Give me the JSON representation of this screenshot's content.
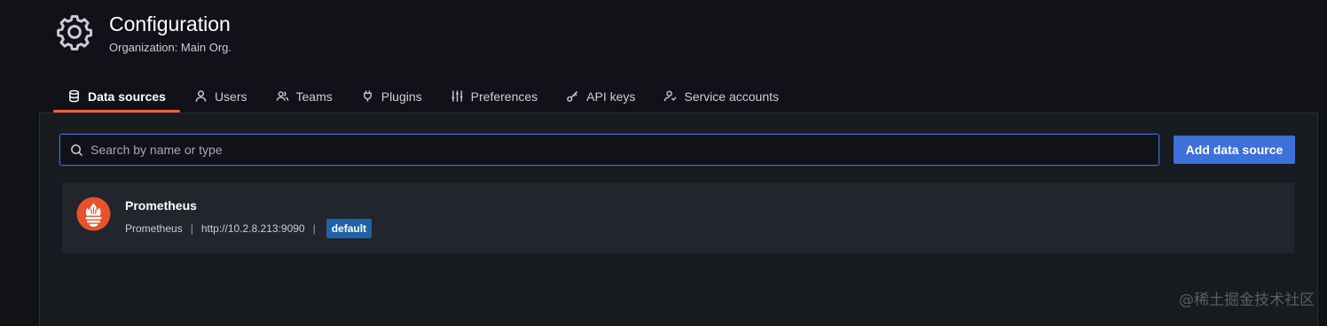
{
  "header": {
    "title": "Configuration",
    "subtitle": "Organization: Main Org."
  },
  "tabs": [
    {
      "label": "Data sources",
      "icon": "database-icon",
      "active": true
    },
    {
      "label": "Users",
      "icon": "user-icon",
      "active": false
    },
    {
      "label": "Teams",
      "icon": "users-icon",
      "active": false
    },
    {
      "label": "Plugins",
      "icon": "plug-icon",
      "active": false
    },
    {
      "label": "Preferences",
      "icon": "sliders-icon",
      "active": false
    },
    {
      "label": "API keys",
      "icon": "key-icon",
      "active": false
    },
    {
      "label": "Service accounts",
      "icon": "user-arrows-icon",
      "active": false
    }
  ],
  "search": {
    "placeholder": "Search by name or type",
    "value": ""
  },
  "actions": {
    "add_label": "Add data source"
  },
  "datasources": [
    {
      "name": "Prometheus",
      "type": "Prometheus",
      "url": "http://10.2.8.213:9090",
      "badge": "default",
      "separator": "|"
    }
  ],
  "watermark": "@稀土掘金技术社区",
  "colors": {
    "background": "#111217",
    "panel": "#181b1f",
    "card": "#22252b",
    "primary": "#3d71d9",
    "active_tab": "#f55f3e",
    "badge": "#1f62a8",
    "prometheus": "#e6522c"
  }
}
